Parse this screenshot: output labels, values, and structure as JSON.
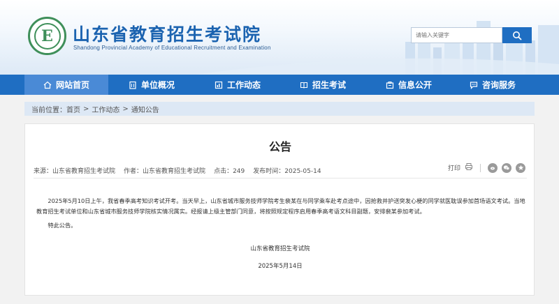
{
  "header": {
    "logo_letter": "E",
    "site_title": "山东省教育招生考试院",
    "site_subtitle": "Shandong Provincial Academy of Educational Recruitment and Examination",
    "search_placeholder": "请输入关键字",
    "colors": {
      "primary": "#1f6ec2",
      "nav_active": "#4a8ad6",
      "logo_green": "#3f8f5a"
    }
  },
  "nav": {
    "items": [
      {
        "label": "网站首页",
        "icon": "home-icon",
        "active": true
      },
      {
        "label": "单位概况",
        "icon": "building-icon",
        "active": false
      },
      {
        "label": "工作动态",
        "icon": "chart-icon",
        "active": false
      },
      {
        "label": "招生考试",
        "icon": "book-icon",
        "active": false
      },
      {
        "label": "信息公开",
        "icon": "folder-icon",
        "active": false
      },
      {
        "label": "咨询服务",
        "icon": "chat-icon",
        "active": false
      }
    ]
  },
  "breadcrumb": {
    "prefix": "当前位置：",
    "items": [
      "首页",
      "工作动态",
      "通知公告"
    ],
    "separator": ">"
  },
  "article": {
    "title": "公告",
    "source_label": "来源：",
    "source": "山东省教育招生考试院",
    "author_label": "作者：",
    "author": "山东省教育招生考试院",
    "clicks_label": "点击：",
    "clicks": "249",
    "published_label": "发布时间：",
    "published": "2025-05-14",
    "print_label": "打印",
    "paragraph1": "2025年5月10日上午，我省春季高考知识考试开考。当天早上，山东省城市服务技师学院考生裴某在与同学乘车赴考点途中，因抢救并护送突发心梗的同学就医耽误参加首场语文考试。当地教育招生考试单位和山东省城市服务技师学院核实情况属实。经报请上级主管部门同意，将按照规定程序启用春季高考语文科目副题，安排裴某参加考试。",
    "paragraph2": "特此公告。",
    "signature": "山东省教育招生考试院",
    "date": "2025年5月14日"
  }
}
